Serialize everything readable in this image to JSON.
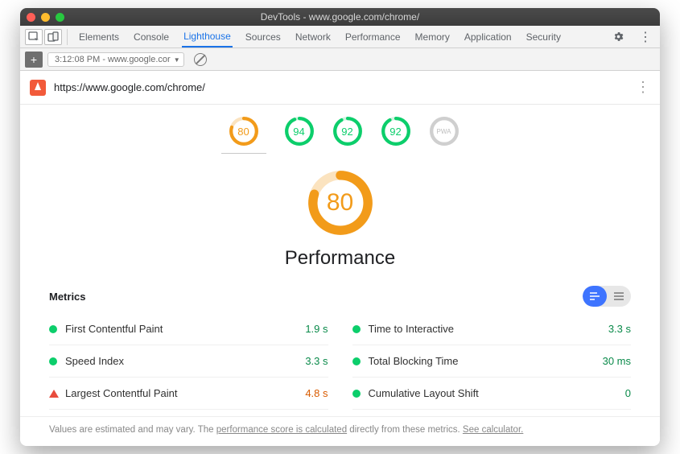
{
  "window": {
    "title": "DevTools - www.google.com/chrome/"
  },
  "tabs": {
    "items": [
      "Elements",
      "Console",
      "Lighthouse",
      "Sources",
      "Network",
      "Performance",
      "Memory",
      "Application",
      "Security"
    ],
    "active_index": 2
  },
  "toolbar": {
    "run_label": "3:12:08 PM - www.google.cor"
  },
  "url_row": {
    "url": "https://www.google.com/chrome/"
  },
  "gauges": {
    "items": [
      {
        "score": "80",
        "color": "#f29b1a",
        "pct": 80
      },
      {
        "score": "94",
        "color": "#0cce6b",
        "pct": 94
      },
      {
        "score": "92",
        "color": "#0cce6b",
        "pct": 92
      },
      {
        "score": "92",
        "color": "#0cce6b",
        "pct": 92
      },
      {
        "score": "PWA",
        "color": "#cfcfcf",
        "pct": 100,
        "muted": true
      }
    ],
    "selected": 0
  },
  "main_gauge": {
    "score": "80",
    "title": "Performance",
    "pct": 80,
    "color": "#f29b1a"
  },
  "metrics": {
    "heading": "Metrics",
    "left": [
      {
        "icon": "green",
        "label": "First Contentful Paint",
        "value": "1.9 s",
        "vclass": "v-green"
      },
      {
        "icon": "green",
        "label": "Speed Index",
        "value": "3.3 s",
        "vclass": "v-green"
      },
      {
        "icon": "tri",
        "label": "Largest Contentful Paint",
        "value": "4.8 s",
        "vclass": "v-orange"
      }
    ],
    "right": [
      {
        "icon": "green",
        "label": "Time to Interactive",
        "value": "3.3 s",
        "vclass": "v-green"
      },
      {
        "icon": "green",
        "label": "Total Blocking Time",
        "value": "30 ms",
        "vclass": "v-green"
      },
      {
        "icon": "green",
        "label": "Cumulative Layout Shift",
        "value": "0",
        "vclass": "v-green"
      }
    ]
  },
  "footnote": {
    "pre": "Values are estimated and may vary. The ",
    "link1": "performance score is calculated",
    "mid": " directly from these metrics. ",
    "link2": "See calculator."
  }
}
